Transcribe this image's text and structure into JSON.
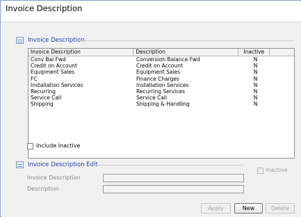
{
  "window": {
    "title": "Invoice Description"
  },
  "list_section": {
    "label": "Invoice Description"
  },
  "grid": {
    "columns": [
      "Invoice Description",
      "Description",
      "Inactive"
    ],
    "rows": [
      [
        "Conv Bal Fwd",
        "Conversion Balance Fwd",
        "N"
      ],
      [
        "Credit on Account",
        "Credit on Account",
        "N"
      ],
      [
        "Equipment Sales",
        "Equipment Sales",
        "N"
      ],
      [
        "FC",
        "Finance Charges",
        "N"
      ],
      [
        "Installation Services",
        "Installation Services",
        "N"
      ],
      [
        "Recurring",
        "Recurring Services",
        "N"
      ],
      [
        "Service Call",
        "Service Call",
        "N"
      ],
      [
        "Shipping",
        "Shipping & Handling",
        "N"
      ]
    ]
  },
  "include_inactive": {
    "label": "Include Inactive",
    "checked": false
  },
  "edit_section": {
    "label": "Invoice Description Edit",
    "inactive_label": "Inactive",
    "invoice_description_label": "Invoice Description",
    "invoice_description_value": "",
    "description_label": "Description",
    "description_value": ""
  },
  "buttons": {
    "apply": "Apply",
    "new": "New",
    "delete": "Delete"
  },
  "colors": {
    "section_label": "#1f3fa8",
    "content_bg": "#f1f1f1",
    "frame_border": "#7fa0c8"
  }
}
